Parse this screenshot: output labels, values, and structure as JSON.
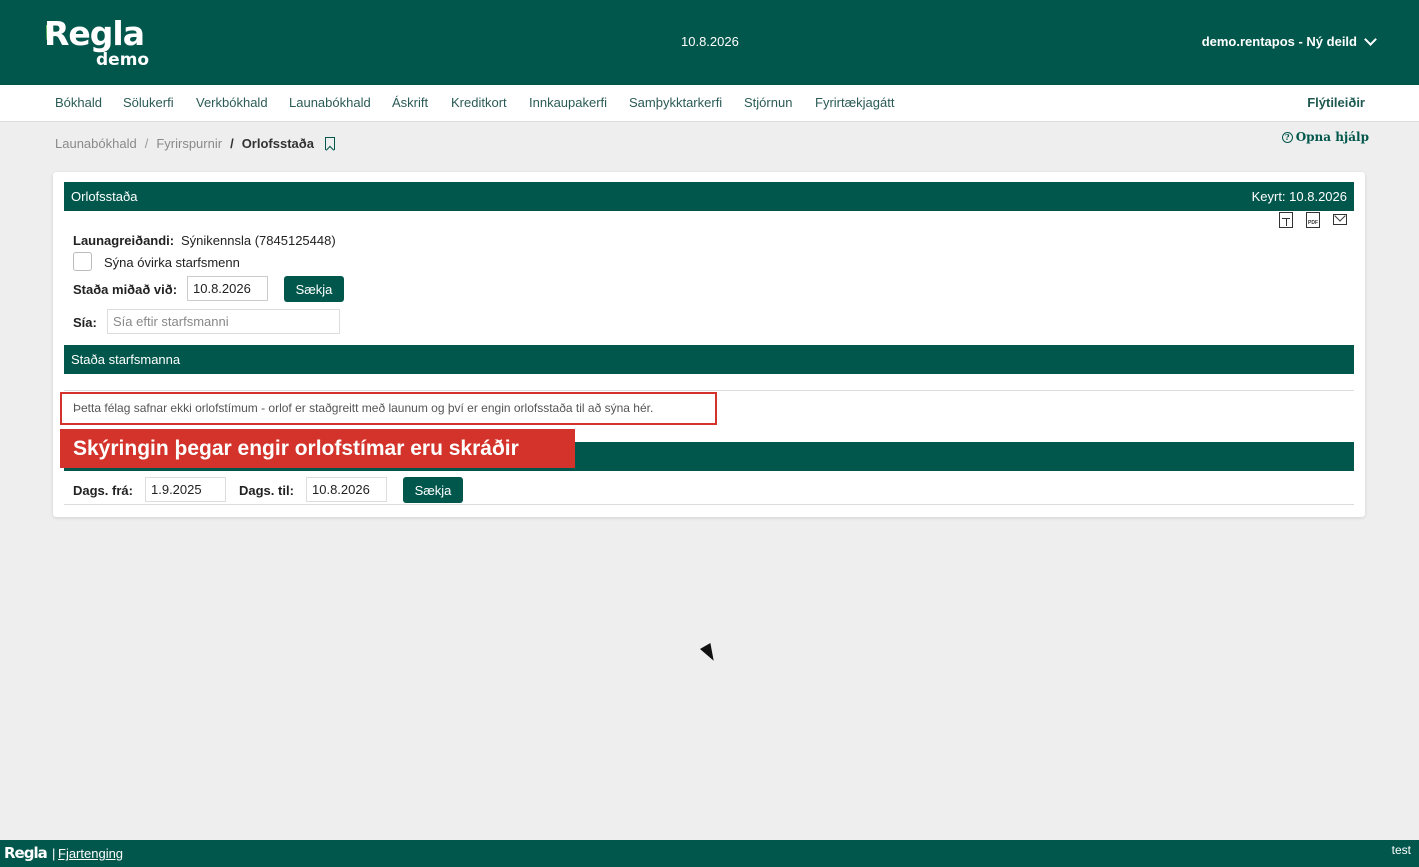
{
  "header": {
    "logo_text": "Regla",
    "logo_sub": "demo",
    "date": "10.8.2026",
    "user": "demo.rentapos - Ný deild"
  },
  "nav": {
    "items": [
      "Bókhald",
      "Sölukerfi",
      "Verkbókhald",
      "Launabókhald",
      "Áskrift",
      "Kreditkort",
      "Innkaupakerfi",
      "Samþykktarkerfi",
      "Stjórnun",
      "Fyrirtækjagátt"
    ],
    "shortcuts": "Flýtileiðir"
  },
  "breadcrumb": {
    "items": [
      "Launabókhald",
      "Fyrirspurnir"
    ],
    "separator": "/",
    "current": "Orlofsstaða"
  },
  "help": {
    "icon_glyph": "?",
    "label": "Opna hjálp"
  },
  "report": {
    "title": "Orlofsstaða",
    "run_label": "Keyrt: 10.8.2026",
    "pdf_glyph": "PDF",
    "employer_label": "Launagreiðandi:",
    "employer_value": "Sýnikennsla (7845125448)",
    "show_inactive_label": "Sýna óvirka starfsmenn",
    "as_of_label": "Staða miðað við:",
    "as_of_value": "10.8.2026",
    "fetch_label": "Sækja",
    "filter_label": "Sía:",
    "filter_placeholder": "Sía eftir starfsmanni"
  },
  "employees_section": {
    "title": "Staða starfsmanna",
    "message": "Þetta félag safnar ekki orlofstímum - orlof er staðgreitt með launum og því er engin orlofsstaða til að sýna hér."
  },
  "callout": {
    "text": "Skýringin þegar engir orlofstímar eru skráðir"
  },
  "date_range": {
    "from_label": "Dags. frá:",
    "from_value": "1.9.2025",
    "to_label": "Dags. til:",
    "to_value": "10.8.2026",
    "fetch_label": "Sækja"
  },
  "footer": {
    "logo": "Regla",
    "separator": "|",
    "link": "Fjartenging",
    "env": "test"
  },
  "colors": {
    "brand": "#02574c",
    "accent_red": "#d3332a",
    "background": "#eeeeee"
  }
}
